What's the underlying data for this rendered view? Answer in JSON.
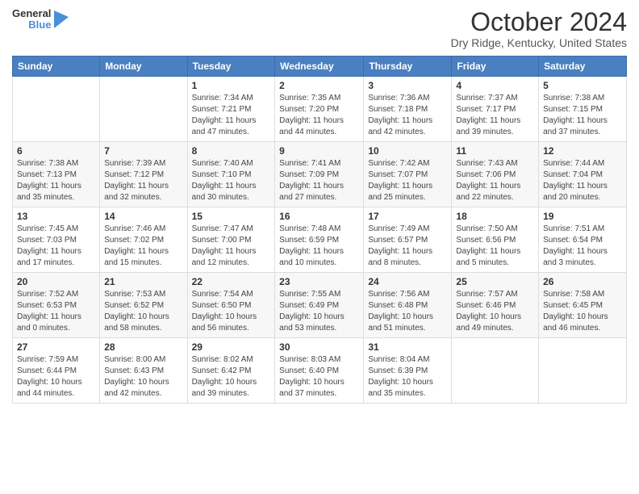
{
  "logo": {
    "general": "General",
    "blue": "Blue"
  },
  "header": {
    "month": "October 2024",
    "location": "Dry Ridge, Kentucky, United States"
  },
  "weekdays": [
    "Sunday",
    "Monday",
    "Tuesday",
    "Wednesday",
    "Thursday",
    "Friday",
    "Saturday"
  ],
  "weeks": [
    [
      {
        "day": "",
        "info": ""
      },
      {
        "day": "",
        "info": ""
      },
      {
        "day": "1",
        "info": "Sunrise: 7:34 AM\nSunset: 7:21 PM\nDaylight: 11 hours and 47 minutes."
      },
      {
        "day": "2",
        "info": "Sunrise: 7:35 AM\nSunset: 7:20 PM\nDaylight: 11 hours and 44 minutes."
      },
      {
        "day": "3",
        "info": "Sunrise: 7:36 AM\nSunset: 7:18 PM\nDaylight: 11 hours and 42 minutes."
      },
      {
        "day": "4",
        "info": "Sunrise: 7:37 AM\nSunset: 7:17 PM\nDaylight: 11 hours and 39 minutes."
      },
      {
        "day": "5",
        "info": "Sunrise: 7:38 AM\nSunset: 7:15 PM\nDaylight: 11 hours and 37 minutes."
      }
    ],
    [
      {
        "day": "6",
        "info": "Sunrise: 7:38 AM\nSunset: 7:13 PM\nDaylight: 11 hours and 35 minutes."
      },
      {
        "day": "7",
        "info": "Sunrise: 7:39 AM\nSunset: 7:12 PM\nDaylight: 11 hours and 32 minutes."
      },
      {
        "day": "8",
        "info": "Sunrise: 7:40 AM\nSunset: 7:10 PM\nDaylight: 11 hours and 30 minutes."
      },
      {
        "day": "9",
        "info": "Sunrise: 7:41 AM\nSunset: 7:09 PM\nDaylight: 11 hours and 27 minutes."
      },
      {
        "day": "10",
        "info": "Sunrise: 7:42 AM\nSunset: 7:07 PM\nDaylight: 11 hours and 25 minutes."
      },
      {
        "day": "11",
        "info": "Sunrise: 7:43 AM\nSunset: 7:06 PM\nDaylight: 11 hours and 22 minutes."
      },
      {
        "day": "12",
        "info": "Sunrise: 7:44 AM\nSunset: 7:04 PM\nDaylight: 11 hours and 20 minutes."
      }
    ],
    [
      {
        "day": "13",
        "info": "Sunrise: 7:45 AM\nSunset: 7:03 PM\nDaylight: 11 hours and 17 minutes."
      },
      {
        "day": "14",
        "info": "Sunrise: 7:46 AM\nSunset: 7:02 PM\nDaylight: 11 hours and 15 minutes."
      },
      {
        "day": "15",
        "info": "Sunrise: 7:47 AM\nSunset: 7:00 PM\nDaylight: 11 hours and 12 minutes."
      },
      {
        "day": "16",
        "info": "Sunrise: 7:48 AM\nSunset: 6:59 PM\nDaylight: 11 hours and 10 minutes."
      },
      {
        "day": "17",
        "info": "Sunrise: 7:49 AM\nSunset: 6:57 PM\nDaylight: 11 hours and 8 minutes."
      },
      {
        "day": "18",
        "info": "Sunrise: 7:50 AM\nSunset: 6:56 PM\nDaylight: 11 hours and 5 minutes."
      },
      {
        "day": "19",
        "info": "Sunrise: 7:51 AM\nSunset: 6:54 PM\nDaylight: 11 hours and 3 minutes."
      }
    ],
    [
      {
        "day": "20",
        "info": "Sunrise: 7:52 AM\nSunset: 6:53 PM\nDaylight: 11 hours and 0 minutes."
      },
      {
        "day": "21",
        "info": "Sunrise: 7:53 AM\nSunset: 6:52 PM\nDaylight: 10 hours and 58 minutes."
      },
      {
        "day": "22",
        "info": "Sunrise: 7:54 AM\nSunset: 6:50 PM\nDaylight: 10 hours and 56 minutes."
      },
      {
        "day": "23",
        "info": "Sunrise: 7:55 AM\nSunset: 6:49 PM\nDaylight: 10 hours and 53 minutes."
      },
      {
        "day": "24",
        "info": "Sunrise: 7:56 AM\nSunset: 6:48 PM\nDaylight: 10 hours and 51 minutes."
      },
      {
        "day": "25",
        "info": "Sunrise: 7:57 AM\nSunset: 6:46 PM\nDaylight: 10 hours and 49 minutes."
      },
      {
        "day": "26",
        "info": "Sunrise: 7:58 AM\nSunset: 6:45 PM\nDaylight: 10 hours and 46 minutes."
      }
    ],
    [
      {
        "day": "27",
        "info": "Sunrise: 7:59 AM\nSunset: 6:44 PM\nDaylight: 10 hours and 44 minutes."
      },
      {
        "day": "28",
        "info": "Sunrise: 8:00 AM\nSunset: 6:43 PM\nDaylight: 10 hours and 42 minutes."
      },
      {
        "day": "29",
        "info": "Sunrise: 8:02 AM\nSunset: 6:42 PM\nDaylight: 10 hours and 39 minutes."
      },
      {
        "day": "30",
        "info": "Sunrise: 8:03 AM\nSunset: 6:40 PM\nDaylight: 10 hours and 37 minutes."
      },
      {
        "day": "31",
        "info": "Sunrise: 8:04 AM\nSunset: 6:39 PM\nDaylight: 10 hours and 35 minutes."
      },
      {
        "day": "",
        "info": ""
      },
      {
        "day": "",
        "info": ""
      }
    ]
  ]
}
